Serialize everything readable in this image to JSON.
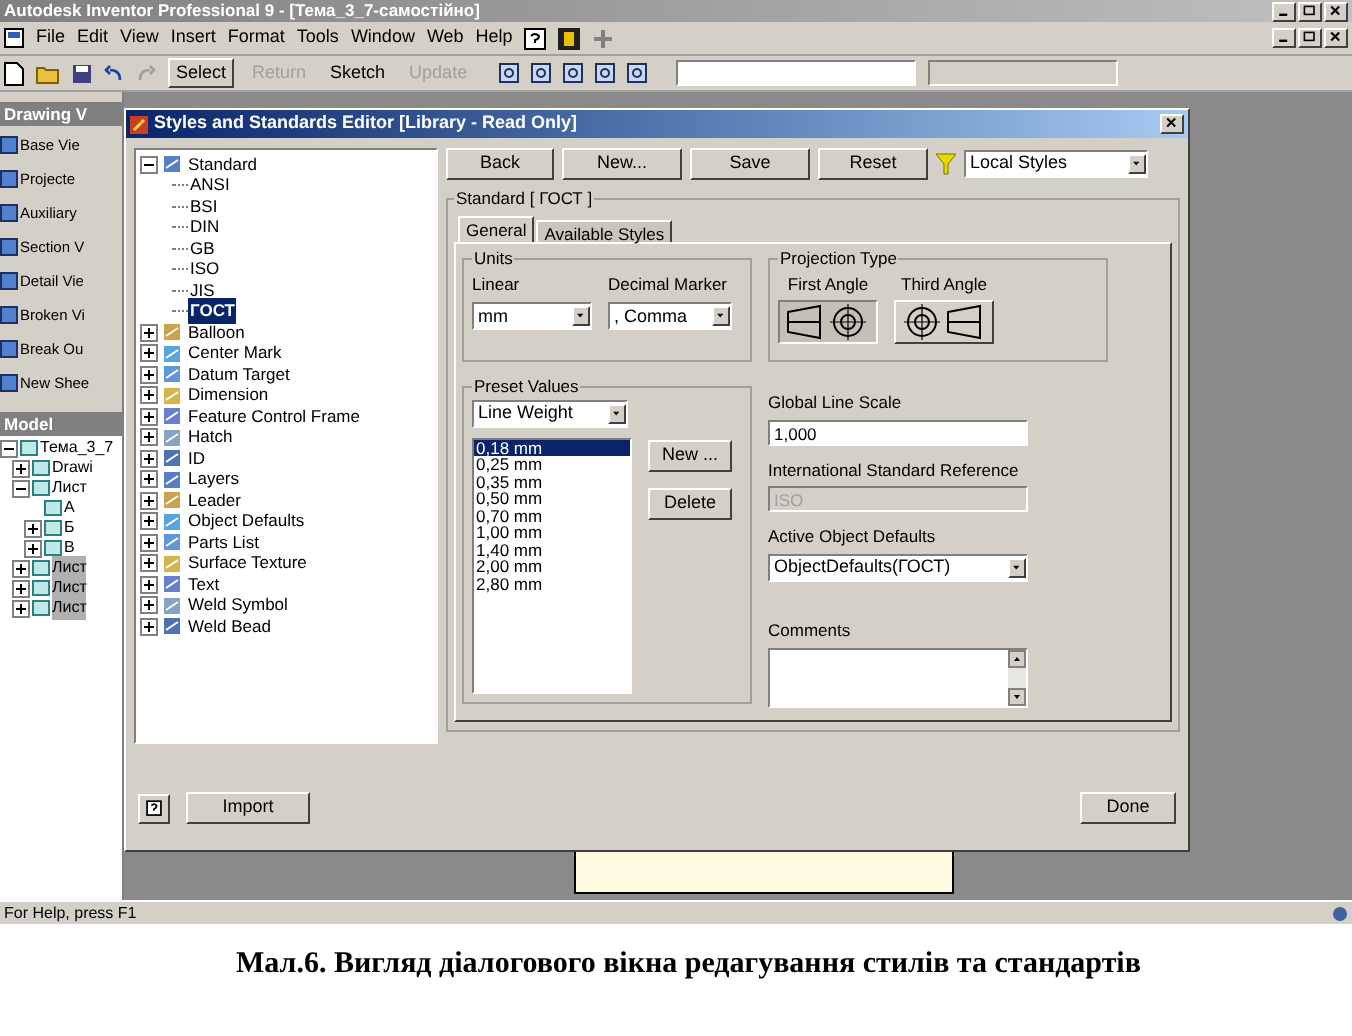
{
  "app_window": {
    "title": "Autodesk Inventor Professional 9 - [Тема_3_7-самостійно]"
  },
  "menu_bar": [
    "File",
    "Edit",
    "View",
    "Insert",
    "Format",
    "Tools",
    "Window",
    "Web",
    "Help"
  ],
  "toolbar": [
    {
      "label": "Select",
      "disabled": false
    },
    {
      "label": "Return",
      "disabled": true
    },
    {
      "label": "Sketch",
      "disabled": false
    },
    {
      "label": "Update",
      "disabled": true
    }
  ],
  "panel_bar": {
    "title": "Drawing V",
    "items": [
      "Base Vie",
      "Projecte",
      "Auxiliary",
      "Section V",
      "Detail Vie",
      "Broken Vi",
      "Break Ou",
      "New Shee"
    ]
  },
  "browser": {
    "title": "Model",
    "tree": [
      {
        "label": "Тема_3_7",
        "expanded": true,
        "selected": false,
        "children": [
          {
            "label": "Drawi",
            "expanded": false,
            "selected": false
          },
          {
            "label": "Лист",
            "expanded": true,
            "selected": false,
            "children": [
              {
                "label": "A",
                "selected": false
              },
              {
                "label": "Б",
                "expanded": false,
                "selected": false
              },
              {
                "label": "B",
                "expanded": false,
                "selected": false
              }
            ]
          },
          {
            "label": "Лист",
            "expanded": false,
            "selected": true
          },
          {
            "label": "Лист",
            "expanded": false,
            "selected": true
          },
          {
            "label": "Лист",
            "expanded": false,
            "selected": true
          }
        ]
      }
    ]
  },
  "dialog": {
    "title": "Styles and Standards Editor [Library - Read Only]",
    "style_tree": [
      {
        "label": "Standard",
        "expanded": true,
        "selected": false,
        "children": [
          {
            "label": "ANSI",
            "selected": false
          },
          {
            "label": "BSI",
            "selected": false
          },
          {
            "label": "DIN",
            "selected": false
          },
          {
            "label": "GB",
            "selected": false
          },
          {
            "label": "ISO",
            "selected": false
          },
          {
            "label": "JIS",
            "selected": false
          },
          {
            "label": "ГОСТ",
            "selected": true
          }
        ]
      },
      {
        "label": "Balloon",
        "expanded": false,
        "selected": false
      },
      {
        "label": "Center Mark",
        "expanded": false,
        "selected": false
      },
      {
        "label": "Datum Target",
        "expanded": false,
        "selected": false
      },
      {
        "label": "Dimension",
        "expanded": false,
        "selected": false
      },
      {
        "label": "Feature Control Frame",
        "expanded": false,
        "selected": false
      },
      {
        "label": "Hatch",
        "expanded": false,
        "selected": false
      },
      {
        "label": "ID",
        "expanded": false,
        "selected": false
      },
      {
        "label": "Layers",
        "expanded": false,
        "selected": false
      },
      {
        "label": "Leader",
        "expanded": false,
        "selected": false
      },
      {
        "label": "Object Defaults",
        "expanded": false,
        "selected": false
      },
      {
        "label": "Parts List",
        "expanded": false,
        "selected": false
      },
      {
        "label": "Surface Texture",
        "expanded": false,
        "selected": false
      },
      {
        "label": "Text",
        "expanded": false,
        "selected": false
      },
      {
        "label": "Weld Symbol",
        "expanded": false,
        "selected": false
      },
      {
        "label": "Weld Bead",
        "expanded": false,
        "selected": false
      }
    ],
    "buttons": [
      "Back",
      "New...",
      "Save",
      "Reset"
    ],
    "filter": {
      "value": "Local Styles"
    },
    "group_title": "Standard [ ГОСТ ]",
    "tabs": [
      {
        "label": "General",
        "selected": true
      },
      {
        "label": "Available Styles",
        "selected": false
      }
    ],
    "units": {
      "title": "Units",
      "linear": {
        "label": "Linear",
        "value": "mm"
      },
      "decimal_marker": {
        "label": "Decimal Marker",
        "value": ", Comma"
      }
    },
    "projection": {
      "title": "Projection Type",
      "options": [
        {
          "label": "First Angle",
          "kind": "first",
          "selected": true
        },
        {
          "label": "Third Angle",
          "kind": "third",
          "selected": false
        }
      ]
    },
    "preset": {
      "title": "Preset Values",
      "type": "Line Weight",
      "values": [
        {
          "text": "0,18 mm",
          "selected": true
        },
        {
          "text": "0,25 mm",
          "selected": false
        },
        {
          "text": "0,35 mm",
          "selected": false
        },
        {
          "text": "0,50 mm",
          "selected": false
        },
        {
          "text": "0,70 mm",
          "selected": false
        },
        {
          "text": "1,00 mm",
          "selected": false
        },
        {
          "text": "1,40 mm",
          "selected": false
        },
        {
          "text": "2,00 mm",
          "selected": false
        },
        {
          "text": "2,80 mm",
          "selected": false
        }
      ],
      "buttons": [
        "New ...",
        "Delete"
      ]
    },
    "global_line_scale": {
      "label": "Global Line Scale",
      "value": "1,000"
    },
    "standard_reference": {
      "label": "International Standard Reference",
      "value": "ISO",
      "disabled": true
    },
    "active_object_defaults": {
      "label": "Active Object Defaults",
      "value": "ObjectDefaults(ГОСТ)"
    },
    "comments": {
      "label": "Comments"
    },
    "import_button": "Import",
    "done_button": "Done"
  },
  "status_bar": "For Help, press F1",
  "caption": "Мал.6. Вигляд діалогового вікна редагування стилів та стандартів"
}
